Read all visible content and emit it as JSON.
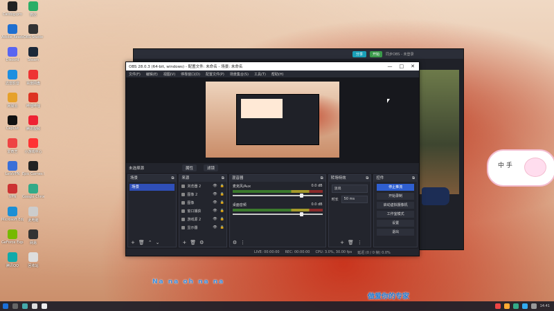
{
  "desktop_icons": [
    {
      "label": "Catdog-pro",
      "color": "#222"
    },
    {
      "label": "微信",
      "color": "#2aae67"
    },
    {
      "label": "Adobe Reader",
      "color": "#1f6fd0"
    },
    {
      "label": "OBS Studio",
      "color": "#333"
    },
    {
      "label": "Discord",
      "color": "#5865f2"
    },
    {
      "label": "Steam",
      "color": "#1b2838"
    },
    {
      "label": "迅雷影音",
      "color": "#1e8fe0"
    },
    {
      "label": "百度网盘",
      "color": "#e33"
    },
    {
      "label": "网易云",
      "color": "#e6a12a"
    },
    {
      "label": "哔哩哔哩",
      "color": "#d32"
    },
    {
      "label": "CapCut",
      "color": "#111"
    },
    {
      "label": "腾讯视频",
      "color": "#e23"
    },
    {
      "label": "爱奇艺",
      "color": "#e44"
    },
    {
      "label": "小游戏中心",
      "color": "#f33"
    },
    {
      "label": "LetsVPN",
      "color": "#3a6fd8"
    },
    {
      "label": "Epic Games Launcher",
      "color": "#222"
    },
    {
      "label": "VPN",
      "color": "#c33"
    },
    {
      "label": "Google Chrome",
      "color": "#3a8"
    },
    {
      "label": "Microsoft Edge",
      "color": "#1d8fd4"
    },
    {
      "label": "此电脑",
      "color": "#ccc"
    },
    {
      "label": "GeForce Experience",
      "color": "#76b900"
    },
    {
      "label": "网易",
      "color": "#333"
    },
    {
      "label": "腾讯QQ",
      "color": "#1aa"
    },
    {
      "label": "回收站",
      "color": "#ddd"
    }
  ],
  "obs": {
    "title": "OBS 28.0.3 (64-bit, windows) - 配置文件: 未命名 - 场景: 未命名",
    "menu": [
      "文件(F)",
      "编辑(E)",
      "视图(V)",
      "停靠窗口(D)",
      "配置文件(P)",
      "场景集合(S)",
      "工具(T)",
      "帮助(H)"
    ],
    "window_controls": [
      "—",
      "□",
      "✕"
    ],
    "source_bar": {
      "label": "未选择源",
      "props_btn": "属性",
      "filter_btn": "滤镜"
    },
    "scenes": {
      "title": "场景",
      "items": [
        "场景"
      ]
    },
    "sources": {
      "title": "来源",
      "items": [
        "浏览器 2",
        "图像 2",
        "图像",
        "窗口捕获",
        "游戏源 2",
        "显示器"
      ]
    },
    "mixer": {
      "title": "混音器",
      "channels": [
        {
          "name": "麦克风/Aux",
          "db": "0.0 dB"
        },
        {
          "name": "桌面音频",
          "db": "0.0 dB"
        }
      ]
    },
    "transitions": {
      "title": "转场特效",
      "type": "淡出",
      "duration_label": "时长",
      "duration": "50 ms"
    },
    "controls": {
      "title": "控件",
      "buttons": [
        "停止推流",
        "开始录制",
        "启动虚拟摄像机",
        "工作室模式",
        "设置",
        "退出"
      ]
    },
    "status": {
      "live": "LIVE: 00:00:00",
      "rec": "REC: 00:00:00",
      "cpu": "CPU: 3.0%, 30.00 fps",
      "dropped": "延迟 (0 / 0 帧) 0.0%"
    }
  },
  "back_window": {
    "title_btn1": "分享",
    "title_btn2": "开始",
    "user": "同步OBS - 未登录"
  },
  "overlay": {
    "pig_text": "中 手"
  },
  "lyrics": {
    "line1": "Na na oh na na",
    "line2": "做爱你的专家"
  },
  "taskbar": {
    "time": "14:41"
  }
}
